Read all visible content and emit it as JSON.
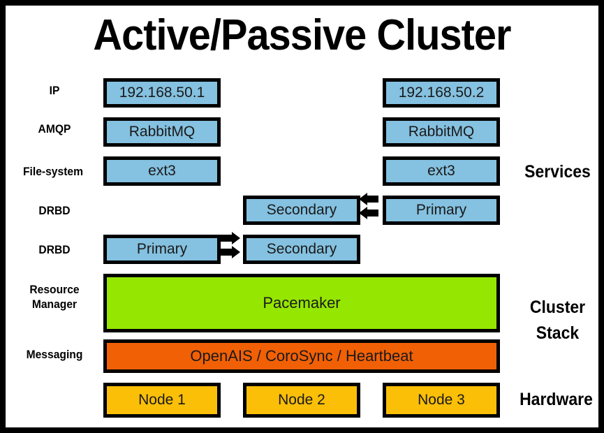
{
  "diagram": {
    "title": "Active/Passive Cluster",
    "row_labels_left": [
      {
        "id": "ip",
        "text": "IP"
      },
      {
        "id": "amqp",
        "text": "AMQP"
      },
      {
        "id": "file-system",
        "text": "File-system"
      },
      {
        "id": "drbd-upper",
        "text": "DRBD"
      },
      {
        "id": "drbd-lower",
        "text": "DRBD"
      },
      {
        "id": "resource-manager-line1",
        "text": "Resource"
      },
      {
        "id": "resource-manager-line2",
        "text": "Manager"
      },
      {
        "id": "messaging",
        "text": "Messaging"
      }
    ],
    "row_labels_right": [
      {
        "id": "services",
        "text": "Services"
      },
      {
        "id": "cluster-stack-line1",
        "text": "Cluster"
      },
      {
        "id": "cluster-stack-line2",
        "text": "Stack"
      },
      {
        "id": "hardware",
        "text": "Hardware"
      }
    ],
    "boxes": {
      "ip_left": "192.168.50.1",
      "ip_right": "192.168.50.2",
      "amqp_left": "RabbitMQ",
      "amqp_right": "RabbitMQ",
      "fs_left": "ext3",
      "fs_right": "ext3",
      "drbd_upper_mid": "Secondary",
      "drbd_upper_right": "Primary",
      "drbd_lower_left": "Primary",
      "drbd_lower_mid": "Secondary",
      "pacemaker": "Pacemaker",
      "messaging_stack": "OpenAIS / CoroSync / Heartbeat",
      "node1": "Node 1",
      "node2": "Node 2",
      "node3": "Node 3"
    },
    "arrows": [
      {
        "id": "drbd-upper-replication-arrow",
        "direction": "left",
        "icon": "arrow-left-icon"
      },
      {
        "id": "drbd-lower-replication-arrow",
        "direction": "right",
        "icon": "arrow-right-icon"
      }
    ],
    "colors": {
      "service_box": "#85C1E0",
      "resource_manager_box": "#95E600",
      "messaging_box": "#F26005",
      "node_box": "#FBBF08",
      "border": "#000000",
      "background": "#FFFFFF"
    }
  }
}
